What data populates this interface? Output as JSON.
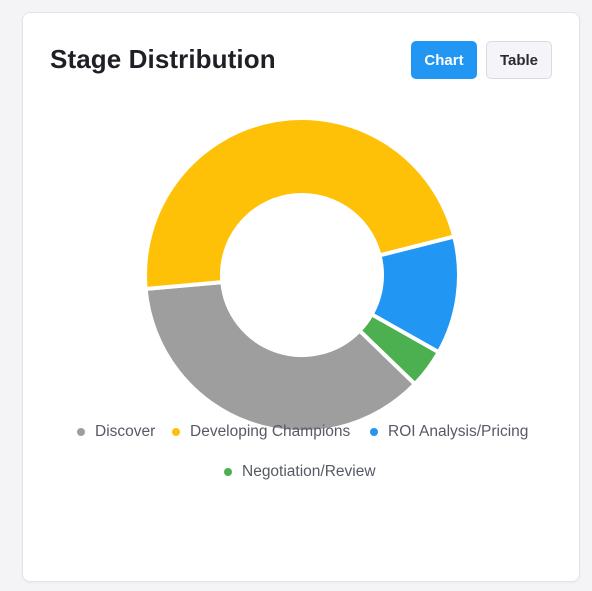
{
  "card": {
    "title": "Stage Distribution"
  },
  "toggle": {
    "chart_label": "Chart",
    "table_label": "Table",
    "active": "Chart"
  },
  "colors": {
    "accent": "#2196f3"
  },
  "chart_data": {
    "type": "pie",
    "variant": "doughnut",
    "categories": [
      "Discover",
      "Developing Champions",
      "ROI Analysis/Pricing",
      "Negotiation/Review"
    ],
    "values": [
      36,
      47,
      12,
      4
    ],
    "colors": [
      "#9e9e9e",
      "#ffc107",
      "#2196f3",
      "#4caf50"
    ],
    "legend_position": "bottom"
  }
}
